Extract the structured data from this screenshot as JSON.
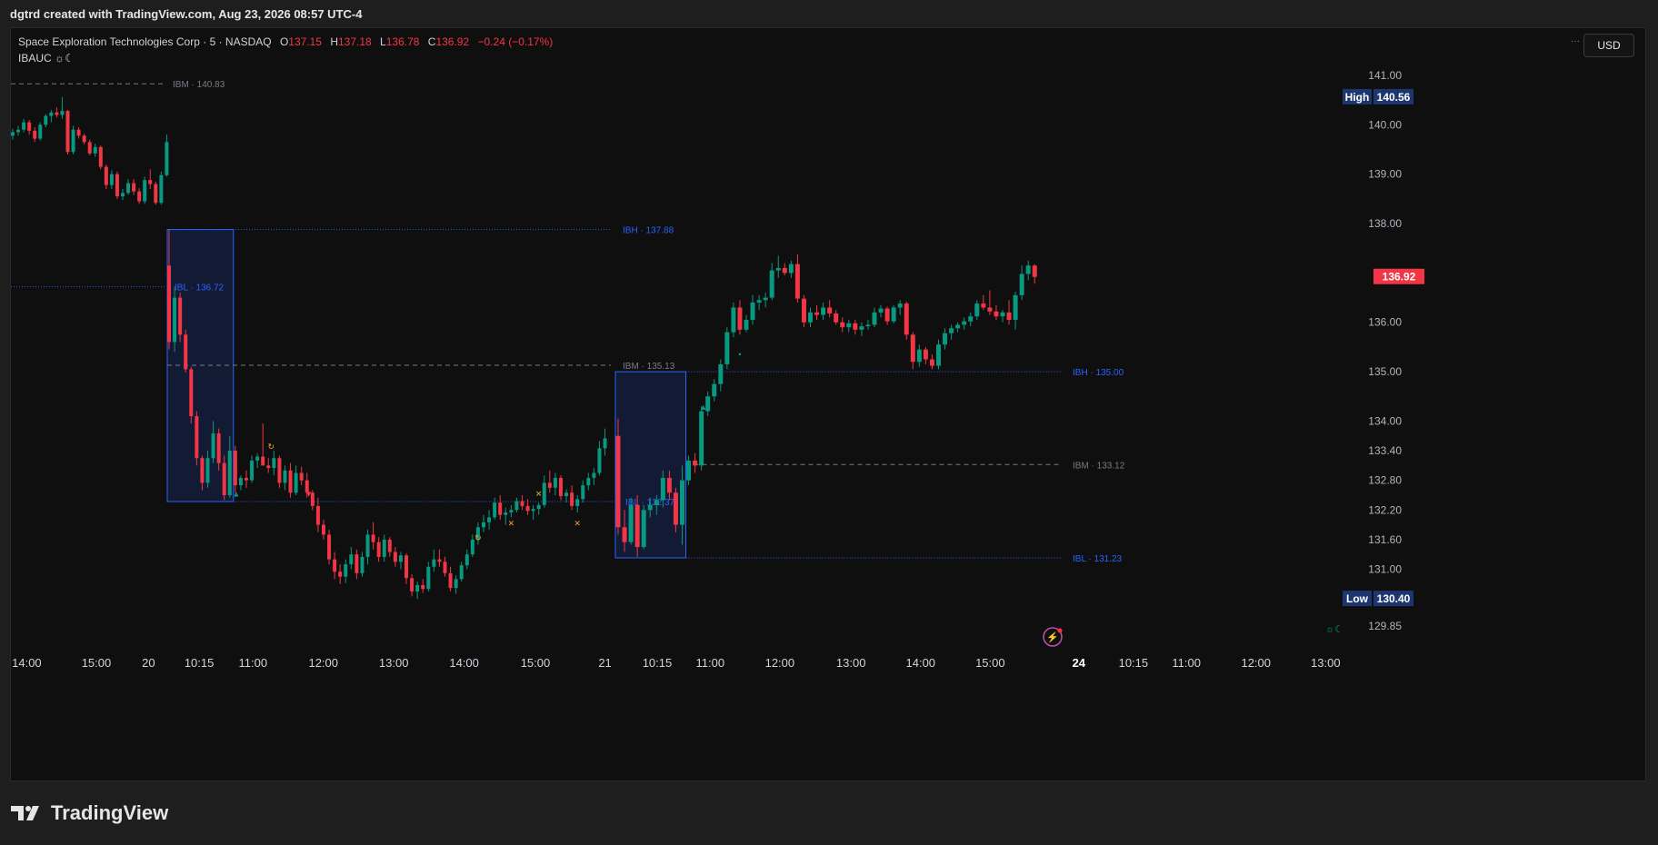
{
  "caption": "dgtrd created with TradingView.com, Aug 23, 2026 08:57 UTC-4",
  "legend": {
    "title": "Space Exploration Technologies Corp · 5 · NASDAQ",
    "o_label": "O",
    "o": "137.15",
    "h_label": "H",
    "h": "137.18",
    "l_label": "L",
    "l": "136.78",
    "c_label": "C",
    "c": "136.92",
    "change": "−0.24 (−0.17%)",
    "indicator": "IBAUC ☼☾"
  },
  "currency_button": "USD",
  "menu_glyph": "···",
  "logo_text": "TradingView",
  "colors": {
    "up": "#089981",
    "down": "#f23645",
    "ib_blue": "#2962ff",
    "ibm_gray": "#787b86",
    "ib_box": "#131a33",
    "high_low_bg": "#1e3670",
    "last_bg": "#f23645"
  },
  "chart_data": {
    "type": "candlestick",
    "title": "Space Exploration Technologies Corp · 5 · NASDAQ",
    "ylim": [
      129.4,
      141.6
    ],
    "y_ticks": [
      "141.00",
      "140.00",
      "139.00",
      "138.00",
      "136.00",
      "135.00",
      "134.00",
      "133.40",
      "132.80",
      "132.20",
      "131.60",
      "131.00",
      "129.85"
    ],
    "y_tick_values": [
      141.0,
      140.0,
      139.0,
      138.0,
      136.0,
      135.0,
      134.0,
      133.4,
      132.8,
      132.2,
      131.6,
      131.0,
      129.85
    ],
    "x_ticks": [
      "14:00",
      "15:00",
      "20",
      "10:15",
      "11:00",
      "12:00",
      "13:00",
      "14:00",
      "15:00",
      "21",
      "10:15",
      "11:00",
      "12:00",
      "13:00",
      "14:00",
      "15:00",
      "24",
      "10:15",
      "11:00",
      "12:00",
      "13:00"
    ],
    "x_tick_bold": [
      false,
      false,
      false,
      false,
      false,
      false,
      false,
      false,
      false,
      false,
      false,
      false,
      false,
      false,
      false,
      false,
      true,
      false,
      false,
      false,
      false
    ],
    "high_label": "High",
    "high_value": "140.56",
    "high": 140.56,
    "low_label": "Low",
    "low_value": "130.40",
    "low": 130.4,
    "last_value": "136.92",
    "last": 136.92,
    "levels": [
      {
        "label": "IBM · 140.83",
        "value": 140.83,
        "kind": "ibm"
      },
      {
        "label": "IBH · 137.88",
        "value": 137.88,
        "kind": "ibh"
      },
      {
        "label": "IBL · 136.72",
        "value": 136.72,
        "kind": "ibl"
      },
      {
        "label": "IBM · 135.13",
        "value": 135.13,
        "kind": "ibm"
      },
      {
        "label": "IBL · 132.37",
        "value": 132.37,
        "kind": "ibl"
      },
      {
        "label": "IBH · 135.00",
        "value": 135.0,
        "kind": "ibh"
      },
      {
        "label": "IBM · 133.12",
        "value": 133.12,
        "kind": "ibm"
      },
      {
        "label": "IBL · 131.23",
        "value": 131.23,
        "kind": "ibl"
      }
    ],
    "day1_candles": [
      [
        139.78,
        139.92,
        139.7,
        139.85
      ],
      [
        139.85,
        139.98,
        139.78,
        139.9
      ],
      [
        139.9,
        140.12,
        139.85,
        140.05
      ],
      [
        140.05,
        140.1,
        139.8,
        139.88
      ],
      [
        139.88,
        139.95,
        139.65,
        139.72
      ],
      [
        139.72,
        140.05,
        139.68,
        140.0
      ],
      [
        140.0,
        140.22,
        139.95,
        140.18
      ],
      [
        140.18,
        140.3,
        140.05,
        140.25
      ],
      [
        140.25,
        140.35,
        140.15,
        140.2
      ],
      [
        140.2,
        140.56,
        140.12,
        140.28
      ],
      [
        140.28,
        140.3,
        139.4,
        139.45
      ],
      [
        139.45,
        139.98,
        139.4,
        139.9
      ],
      [
        139.9,
        139.95,
        139.72,
        139.78
      ],
      [
        139.78,
        139.82,
        139.6,
        139.65
      ],
      [
        139.65,
        139.7,
        139.38,
        139.42
      ],
      [
        139.42,
        139.62,
        139.35,
        139.55
      ],
      [
        139.55,
        139.58,
        139.1,
        139.15
      ],
      [
        139.15,
        139.2,
        138.7,
        138.78
      ],
      [
        138.78,
        139.08,
        138.7,
        139.0
      ],
      [
        139.0,
        139.05,
        138.5,
        138.55
      ],
      [
        138.55,
        138.7,
        138.48,
        138.62
      ],
      [
        138.62,
        138.9,
        138.58,
        138.82
      ],
      [
        138.82,
        138.9,
        138.58,
        138.65
      ],
      [
        138.65,
        138.72,
        138.4,
        138.45
      ],
      [
        138.45,
        138.95,
        138.4,
        138.88
      ],
      [
        138.88,
        139.1,
        138.7,
        138.8
      ],
      [
        138.8,
        138.85,
        138.38,
        138.42
      ],
      [
        138.42,
        139.05,
        138.38,
        138.98
      ],
      [
        138.98,
        139.8,
        138.95,
        139.65
      ]
    ],
    "day2_candles": [
      [
        137.15,
        137.88,
        135.45,
        135.6
      ],
      [
        135.6,
        136.72,
        135.4,
        136.5
      ],
      [
        136.5,
        136.6,
        135.6,
        135.75
      ],
      [
        135.75,
        135.85,
        134.98,
        135.05
      ],
      [
        135.05,
        135.1,
        133.95,
        134.1
      ],
      [
        134.1,
        134.2,
        133.1,
        133.25
      ],
      [
        133.25,
        133.3,
        132.6,
        132.75
      ],
      [
        132.75,
        133.4,
        132.65,
        133.25
      ],
      [
        133.25,
        134.0,
        133.15,
        133.75
      ],
      [
        133.75,
        133.85,
        133.0,
        133.15
      ],
      [
        133.15,
        133.3,
        132.4,
        132.5
      ],
      [
        132.5,
        133.7,
        132.45,
        133.4
      ],
      [
        133.4,
        133.5,
        132.55,
        132.7
      ],
      [
        132.7,
        132.9,
        132.6,
        132.85
      ],
      [
        132.85,
        133.0,
        132.65,
        132.8
      ],
      [
        132.8,
        133.3,
        132.75,
        133.2
      ],
      [
        133.2,
        133.35,
        133.05,
        133.28
      ],
      [
        133.28,
        133.95,
        133.15,
        133.1
      ],
      [
        133.1,
        133.25,
        132.95,
        133.05
      ],
      [
        133.05,
        133.4,
        132.9,
        133.25
      ],
      [
        133.25,
        133.3,
        132.65,
        132.75
      ],
      [
        132.75,
        133.1,
        132.6,
        133.0
      ],
      [
        133.0,
        133.15,
        132.45,
        132.55
      ],
      [
        132.55,
        133.1,
        132.5,
        132.95
      ],
      [
        132.95,
        133.08,
        132.7,
        132.8
      ],
      [
        132.8,
        132.95,
        132.45,
        132.55
      ],
      [
        132.55,
        132.6,
        132.2,
        132.28
      ],
      [
        132.28,
        132.45,
        131.75,
        131.9
      ],
      [
        131.9,
        132.0,
        131.6,
        131.7
      ],
      [
        131.7,
        131.8,
        131.1,
        131.2
      ],
      [
        131.2,
        131.35,
        130.8,
        130.95
      ],
      [
        130.95,
        131.1,
        130.7,
        130.85
      ],
      [
        130.85,
        131.2,
        130.72,
        131.1
      ],
      [
        131.1,
        131.45,
        131.0,
        131.3
      ],
      [
        131.3,
        131.4,
        130.8,
        130.92
      ],
      [
        130.92,
        131.35,
        130.85,
        131.25
      ],
      [
        131.25,
        131.8,
        131.1,
        131.7
      ],
      [
        131.7,
        131.95,
        131.4,
        131.55
      ],
      [
        131.55,
        131.65,
        131.15,
        131.25
      ],
      [
        131.25,
        131.7,
        131.15,
        131.6
      ],
      [
        131.6,
        131.65,
        131.25,
        131.35
      ],
      [
        131.35,
        131.45,
        131.05,
        131.15
      ],
      [
        131.15,
        131.35,
        131.0,
        131.28
      ],
      [
        131.28,
        131.32,
        130.7,
        130.82
      ],
      [
        130.82,
        130.9,
        130.45,
        130.55
      ],
      [
        130.55,
        130.75,
        130.4,
        130.68
      ],
      [
        130.68,
        130.8,
        130.52,
        130.6
      ],
      [
        130.6,
        131.15,
        130.55,
        131.05
      ],
      [
        131.05,
        131.4,
        130.95,
        131.2
      ],
      [
        131.2,
        131.4,
        131.05,
        131.15
      ],
      [
        131.15,
        131.25,
        130.85,
        130.92
      ],
      [
        130.92,
        131.05,
        130.55,
        130.62
      ],
      [
        130.62,
        130.88,
        130.5,
        130.8
      ],
      [
        130.8,
        131.15,
        130.75,
        131.08
      ],
      [
        131.08,
        131.4,
        131.0,
        131.3
      ],
      [
        131.3,
        131.7,
        131.25,
        131.6
      ],
      [
        131.6,
        131.95,
        131.5,
        131.85
      ],
      [
        131.85,
        132.1,
        131.75,
        131.95
      ],
      [
        131.95,
        132.2,
        131.8,
        132.05
      ],
      [
        132.05,
        132.45,
        132.0,
        132.35
      ],
      [
        132.35,
        132.5,
        132.0,
        132.1
      ],
      [
        132.1,
        132.25,
        131.9,
        132.15
      ],
      [
        132.15,
        132.3,
        132.05,
        132.2
      ],
      [
        132.2,
        132.45,
        132.15,
        132.38
      ],
      [
        132.38,
        132.5,
        132.2,
        132.28
      ],
      [
        132.28,
        132.42,
        132.1,
        132.18
      ],
      [
        132.18,
        132.3,
        132.0,
        132.22
      ],
      [
        132.22,
        132.35,
        132.1,
        132.3
      ],
      [
        132.3,
        132.9,
        132.25,
        132.75
      ],
      [
        132.75,
        133.0,
        132.55,
        132.65
      ],
      [
        132.65,
        132.95,
        132.5,
        132.85
      ],
      [
        132.85,
        132.9,
        132.4,
        132.48
      ],
      [
        132.48,
        132.62,
        132.35,
        132.55
      ],
      [
        132.55,
        132.7,
        132.2,
        132.28
      ],
      [
        132.28,
        132.5,
        132.15,
        132.42
      ],
      [
        132.42,
        132.8,
        132.35,
        132.7
      ],
      [
        132.7,
        132.95,
        132.6,
        132.85
      ],
      [
        132.85,
        133.05,
        132.7,
        132.95
      ],
      [
        132.95,
        133.6,
        132.9,
        133.45
      ],
      [
        133.45,
        133.85,
        133.3,
        133.65
      ]
    ],
    "day3_candles": [
      [
        133.7,
        134.05,
        131.7,
        131.85
      ],
      [
        131.85,
        132.2,
        131.35,
        131.55
      ],
      [
        131.55,
        132.45,
        131.5,
        132.3
      ],
      [
        132.3,
        132.5,
        131.25,
        131.45
      ],
      [
        131.45,
        132.3,
        131.4,
        132.2
      ],
      [
        132.2,
        132.45,
        132.05,
        132.3
      ],
      [
        132.3,
        132.5,
        132.1,
        132.4
      ],
      [
        132.4,
        133.0,
        132.25,
        132.85
      ],
      [
        132.85,
        133.0,
        132.4,
        132.55
      ],
      [
        132.55,
        132.65,
        131.75,
        131.9
      ],
      [
        131.9,
        133.1,
        131.5,
        132.8
      ],
      [
        132.8,
        133.3,
        132.7,
        133.2
      ],
      [
        133.2,
        133.35,
        132.95,
        133.1
      ],
      [
        133.1,
        134.3,
        133.0,
        134.2
      ],
      [
        134.2,
        134.6,
        134.1,
        134.5
      ],
      [
        134.5,
        134.85,
        134.4,
        134.75
      ],
      [
        134.75,
        135.25,
        134.6,
        135.15
      ],
      [
        135.15,
        135.9,
        135.05,
        135.8
      ],
      [
        135.8,
        136.4,
        135.7,
        136.3
      ],
      [
        136.3,
        136.45,
        135.75,
        135.85
      ],
      [
        135.85,
        136.15,
        135.8,
        136.05
      ],
      [
        136.05,
        136.55,
        135.95,
        136.4
      ],
      [
        136.4,
        136.55,
        136.25,
        136.45
      ],
      [
        136.45,
        136.6,
        136.3,
        136.5
      ],
      [
        136.5,
        137.2,
        136.45,
        137.05
      ],
      [
        137.05,
        137.35,
        136.9,
        137.1
      ],
      [
        137.1,
        137.2,
        136.95,
        137.0
      ],
      [
        137.0,
        137.25,
        136.9,
        137.18
      ],
      [
        137.18,
        137.38,
        136.4,
        136.48
      ],
      [
        136.48,
        136.55,
        135.9,
        136.0
      ],
      [
        136.0,
        136.3,
        135.9,
        136.2
      ],
      [
        136.2,
        136.35,
        136.05,
        136.15
      ],
      [
        136.15,
        136.4,
        136.05,
        136.3
      ],
      [
        136.3,
        136.45,
        136.1,
        136.18
      ],
      [
        136.18,
        136.25,
        135.95,
        136.0
      ],
      [
        136.0,
        136.1,
        135.8,
        135.9
      ],
      [
        135.9,
        136.05,
        135.8,
        135.98
      ],
      [
        135.98,
        136.05,
        135.75,
        135.85
      ],
      [
        135.85,
        136.0,
        135.72,
        135.92
      ],
      [
        135.92,
        136.05,
        135.85,
        135.95
      ],
      [
        135.95,
        136.3,
        135.9,
        136.2
      ],
      [
        136.2,
        136.35,
        136.1,
        136.28
      ],
      [
        136.28,
        136.32,
        135.95,
        136.02
      ],
      [
        136.02,
        136.35,
        135.98,
        136.3
      ],
      [
        136.3,
        136.45,
        136.15,
        136.38
      ],
      [
        136.38,
        136.42,
        135.65,
        135.75
      ],
      [
        135.75,
        135.8,
        135.05,
        135.2
      ],
      [
        135.2,
        135.55,
        135.1,
        135.45
      ],
      [
        135.45,
        135.5,
        135.15,
        135.25
      ],
      [
        135.25,
        135.35,
        135.05,
        135.12
      ],
      [
        135.12,
        135.65,
        135.05,
        135.55
      ],
      [
        135.55,
        135.88,
        135.45,
        135.78
      ],
      [
        135.78,
        135.95,
        135.65,
        135.88
      ],
      [
        135.88,
        136.0,
        135.8,
        135.95
      ],
      [
        135.95,
        136.1,
        135.85,
        136.02
      ],
      [
        136.02,
        136.2,
        135.92,
        136.12
      ],
      [
        136.12,
        136.45,
        136.05,
        136.38
      ],
      [
        136.38,
        136.55,
        136.25,
        136.3
      ],
      [
        136.3,
        136.65,
        136.15,
        136.22
      ],
      [
        136.22,
        136.35,
        136.05,
        136.12
      ],
      [
        136.12,
        136.25,
        136.0,
        136.2
      ],
      [
        136.2,
        136.45,
        135.95,
        136.05
      ],
      [
        136.05,
        136.62,
        135.85,
        136.55
      ],
      [
        136.55,
        137.15,
        136.45,
        136.98
      ],
      [
        136.98,
        137.25,
        136.85,
        137.15
      ],
      [
        137.15,
        137.18,
        136.78,
        136.92
      ]
    ]
  }
}
